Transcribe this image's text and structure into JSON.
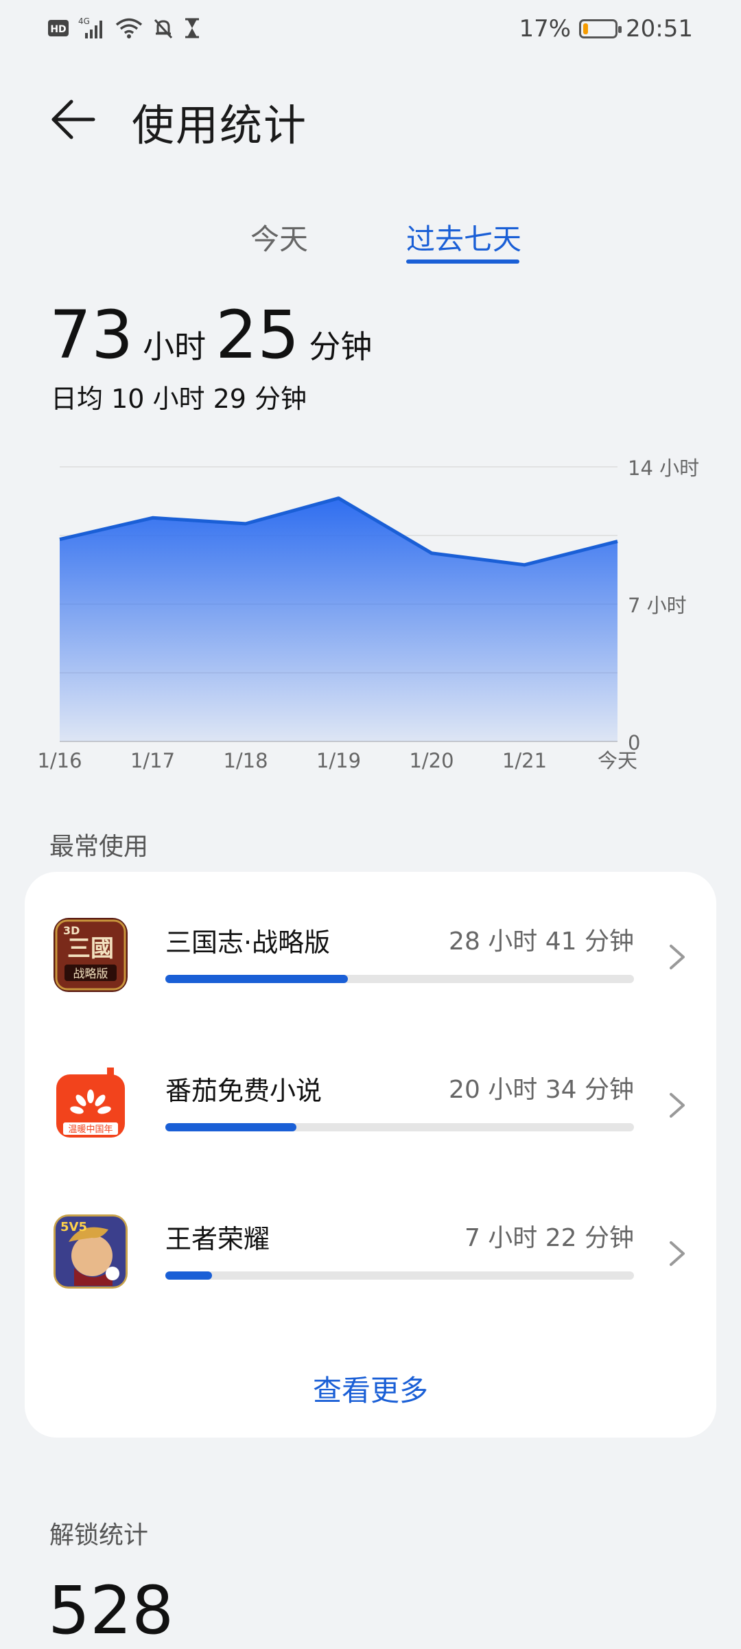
{
  "status_bar": {
    "hd": "HD",
    "network": "4G",
    "battery_percent": "17%",
    "battery_level": 0.17,
    "time": "20:51",
    "icons": [
      "hd-icon",
      "signal-icon",
      "wifi-icon",
      "mute-bell-icon",
      "hourglass-icon",
      "battery-icon"
    ]
  },
  "header": {
    "title": "使用统计"
  },
  "tabs": [
    {
      "label": "今天",
      "active": false
    },
    {
      "label": "过去七天",
      "active": true
    }
  ],
  "summary": {
    "hours": "73",
    "hours_unit": "小时",
    "minutes": "25",
    "minutes_unit": "分钟",
    "daily_avg": "日均 10 小时 29 分钟"
  },
  "chart_data": {
    "type": "area",
    "categories": [
      "1/16",
      "1/17",
      "1/18",
      "1/19",
      "1/20",
      "1/21",
      "今天"
    ],
    "values": [
      10.3,
      11.4,
      11.1,
      12.4,
      9.6,
      9.0,
      10.2
    ],
    "ylim": [
      0,
      14
    ],
    "y_tick_labels": [
      "14 小时",
      "7 小时",
      "0"
    ],
    "y_ticks": [
      14,
      7,
      0
    ],
    "grid": true,
    "color": "#1a5fd6"
  },
  "most_used": {
    "label": "最常使用",
    "apps": [
      {
        "name": "三国志·战略版",
        "time": "28 小时 41 分钟",
        "share": 0.39
      },
      {
        "name": "番茄免费小说",
        "time": "20 小时 34 分钟",
        "share": 0.28
      },
      {
        "name": "王者荣耀",
        "time": "7 小时 22 分钟",
        "share": 0.1
      }
    ],
    "more": "查看更多"
  },
  "unlock": {
    "label": "解锁统计",
    "count": "528"
  }
}
